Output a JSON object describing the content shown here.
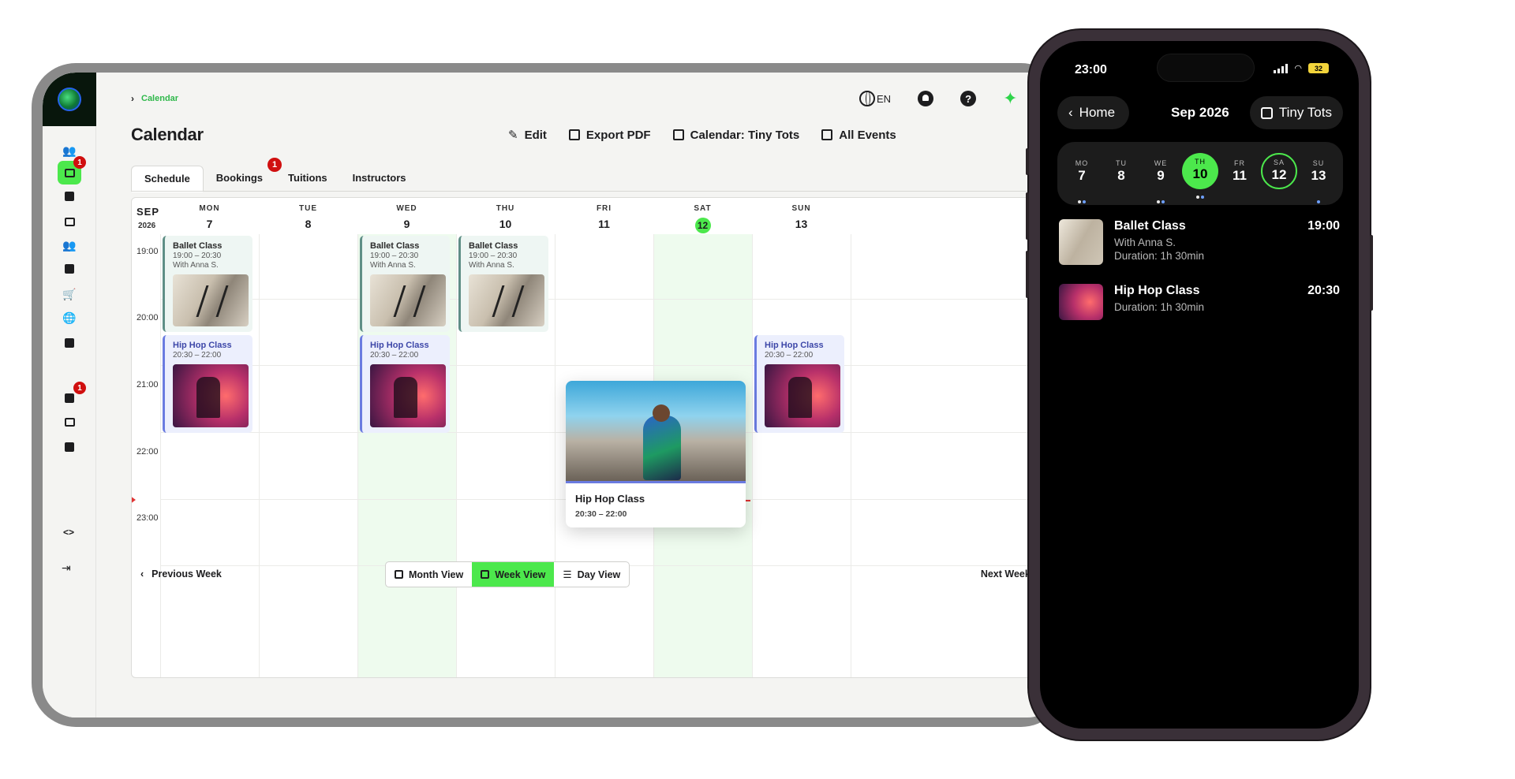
{
  "tablet": {
    "breadcrumb": {
      "current": "Calendar"
    },
    "language": "EN",
    "page_title": "Calendar",
    "actions": {
      "edit": "Edit",
      "export": "Export PDF",
      "calendar": "Calendar: Tiny Tots",
      "events": "All Events"
    },
    "sidebar_badges": {
      "calendar": "1",
      "contacts": "1"
    },
    "tabs": [
      {
        "label": "Schedule",
        "active": true
      },
      {
        "label": "Bookings",
        "badge": "1"
      },
      {
        "label": "Tuitions"
      },
      {
        "label": "Instructors"
      }
    ],
    "calendar": {
      "month": "SEP",
      "year": "2026",
      "days": [
        {
          "name": "MON",
          "num": "7"
        },
        {
          "name": "TUE",
          "num": "8"
        },
        {
          "name": "WED",
          "num": "9"
        },
        {
          "name": "THU",
          "num": "10"
        },
        {
          "name": "FRI",
          "num": "11"
        },
        {
          "name": "SAT",
          "num": "12",
          "today": true
        },
        {
          "name": "SUN",
          "num": "13"
        }
      ],
      "times": [
        "19:00",
        "20:00",
        "21:00",
        "22:00",
        "23:00"
      ],
      "ballet": {
        "title": "Ballet Class",
        "time": "19:00 – 20:30",
        "instructor": "With Anna S."
      },
      "hiphop": {
        "title": "Hip Hop Class",
        "time": "20:30 – 22:00"
      },
      "popup": {
        "title": "Hip Hop Class",
        "time": "20:30 – 22:00"
      }
    },
    "footer": {
      "previous": "Previous Week",
      "next": "Next Week",
      "views": [
        {
          "label": "Month View"
        },
        {
          "label": "Week View",
          "active": true
        },
        {
          "label": "Day View"
        }
      ]
    },
    "accent_color": "#4ce84c"
  },
  "phone": {
    "status": {
      "time": "23:00",
      "battery": "32"
    },
    "back_label": "Home",
    "month_title": "Sep 2026",
    "school_label": "Tiny Tots",
    "week": [
      {
        "wd": "MO",
        "wn": "7"
      },
      {
        "wd": "TU",
        "wn": "8"
      },
      {
        "wd": "WE",
        "wn": "9"
      },
      {
        "wd": "TH",
        "wn": "10",
        "selected": true
      },
      {
        "wd": "FR",
        "wn": "11"
      },
      {
        "wd": "SA",
        "wn": "12",
        "today": true
      },
      {
        "wd": "SU",
        "wn": "13"
      }
    ],
    "agenda": [
      {
        "title": "Ballet Class",
        "time": "19:00",
        "line1": "With Anna S.",
        "line2": "Duration: 1h 30min"
      },
      {
        "title": "Hip Hop Class",
        "time": "20:30",
        "line1": "Duration: 1h 30min"
      }
    ]
  }
}
